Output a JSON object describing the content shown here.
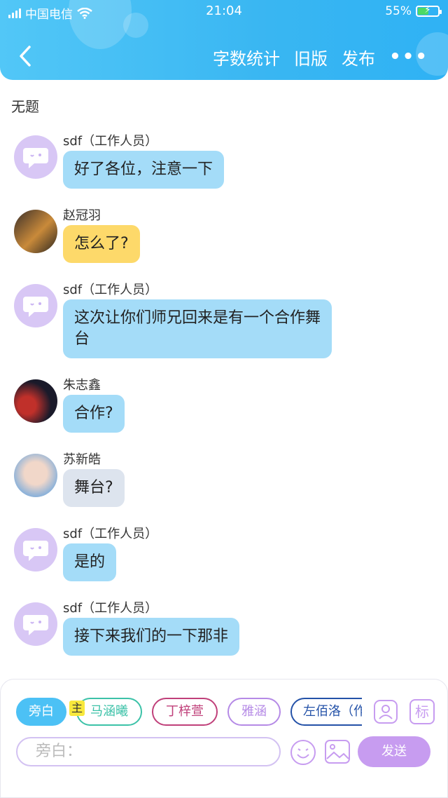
{
  "status_bar": {
    "carrier": "中国电信",
    "time": "21:04",
    "battery": "55%",
    "battery_level": 0.55
  },
  "nav": {
    "actions": [
      "字数统计",
      "旧版",
      "发布"
    ],
    "more": "•••"
  },
  "doc_title": "无题",
  "messages": [
    {
      "name": "sdf（工作人员）",
      "text": "好了各位，注意一下",
      "style": "blue",
      "avatar": "staff"
    },
    {
      "name": "赵冠羽",
      "text": "怎么了?",
      "style": "yellow",
      "avatar": "photo"
    },
    {
      "name": "sdf（工作人员）",
      "text": "这次让你们师兄回来是有一个合作舞台",
      "style": "blue",
      "avatar": "staff"
    },
    {
      "name": "朱志鑫",
      "text": "合作?",
      "style": "blue",
      "avatar": "photo"
    },
    {
      "name": "苏新皓",
      "text": "舞台?",
      "style": "gray",
      "avatar": "photo"
    },
    {
      "name": "sdf（工作人员）",
      "text": "是的",
      "style": "blue",
      "avatar": "staff"
    },
    {
      "name": "sdf（工作人员）",
      "text": "接下来我们的一下那非",
      "style": "blue",
      "avatar": "staff"
    }
  ],
  "composer": {
    "chips": [
      {
        "label": "旁白",
        "active": true
      },
      {
        "label": "马涵曦",
        "color": "#3cc2a8"
      },
      {
        "label": "丁梓萱",
        "color": "#c0407a"
      },
      {
        "label": "雅涵",
        "color": "#b58ae6"
      },
      {
        "label": "左佰洛（作",
        "color": "#2452a8"
      }
    ],
    "main_badge": "主",
    "mark_label": "标",
    "placeholder": "旁白：",
    "send_label": "发送"
  },
  "colors": {
    "header": "#39b6f2",
    "bubble_blue": "#a4dcf8",
    "bubble_yellow": "#fdd96a",
    "bubble_gray": "#dde4ee",
    "send": "#c79cf0"
  }
}
